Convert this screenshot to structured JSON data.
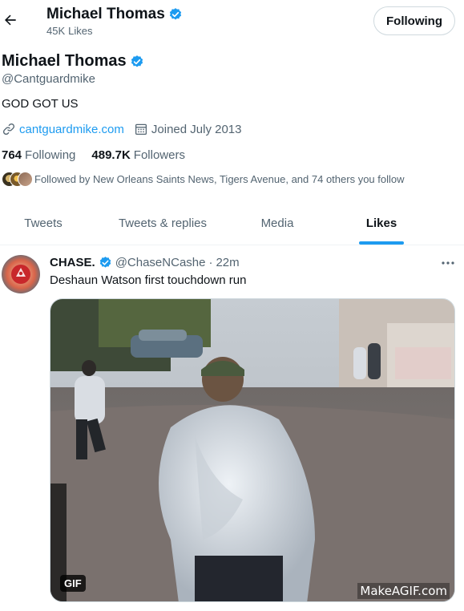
{
  "header": {
    "name": "Michael Thomas",
    "likes_count": "45K",
    "likes_label": "Likes",
    "follow_button_label": "Following"
  },
  "profile": {
    "name": "Michael Thomas",
    "handle": "@Cantguardmike",
    "bio": "GOD GOT US",
    "website": "cantguardmike.com",
    "joined": "Joined July 2013",
    "following_count": "764",
    "following_label": "Following",
    "followers_count": "489.7K",
    "followers_label": "Followers",
    "followed_by": "Followed by New Orleans Saints News, Tigers Avenue, and 74 others you follow"
  },
  "tabs": [
    {
      "label": "Tweets",
      "active": false
    },
    {
      "label": "Tweets & replies",
      "active": false
    },
    {
      "label": "Media",
      "active": false
    },
    {
      "label": "Likes",
      "active": true
    }
  ],
  "tweet": {
    "author": "CHASE.",
    "handle": "@ChaseNCashe",
    "separator": "·",
    "time": "22m",
    "text": "Deshaun Watson first touchdown run",
    "media_badge": "GIF",
    "media_watermark": "MakeAGIF.com"
  },
  "colors": {
    "accent": "#1d9bf0",
    "text_primary": "#0f1419",
    "text_secondary": "#536471",
    "border": "#cfd9de"
  },
  "icons": {
    "back": "arrow-left-icon",
    "verified": "verified-badge-icon",
    "link": "link-icon",
    "calendar": "calendar-icon",
    "more": "more-horizontal-icon"
  }
}
